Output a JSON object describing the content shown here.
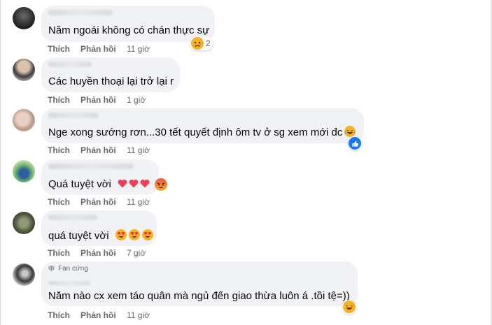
{
  "actions": {
    "like_label": "Thích",
    "reply_label": "Phản hồi"
  },
  "comments": [
    {
      "text": "Năm ngoái không có chán thực sự",
      "time": "11 giờ",
      "reaction_count": "2",
      "reaction_icon": "sad-face-icon"
    },
    {
      "text": "Các huyền thoại lại trở lại r",
      "time": "1 giờ"
    },
    {
      "text": "Nge xong sướng rơn...30 tết quyết định ôm tv ở sg xem mới đc",
      "time": "11 giờ",
      "reaction_icon": "like-icon"
    },
    {
      "text": "Quá tuyệt vời",
      "time": "11 giờ",
      "trailing_icons": [
        "heart-icon",
        "heart-icon",
        "heart-icon"
      ],
      "reaction_icon": "angry-face-icon"
    },
    {
      "text": "quá tuyệt vời",
      "time": "7 giờ",
      "trailing_icons": [
        "heart-eyes-icon",
        "heart-eyes-icon",
        "heart-eyes-icon"
      ]
    },
    {
      "badge": "Fan cứng",
      "text": "Năm nào cx xem táo quân mà ngủ đến giao thừa luôn á .tồi tệ=))",
      "time": "11 giờ",
      "reaction_icon": "laughing-face-icon"
    }
  ],
  "colors": {
    "bubble": "#f0f2f5",
    "meta": "#65676b",
    "like_blue": "#1877f2",
    "heart": "#f33e58",
    "emoji_yellow": "#f7b125"
  }
}
